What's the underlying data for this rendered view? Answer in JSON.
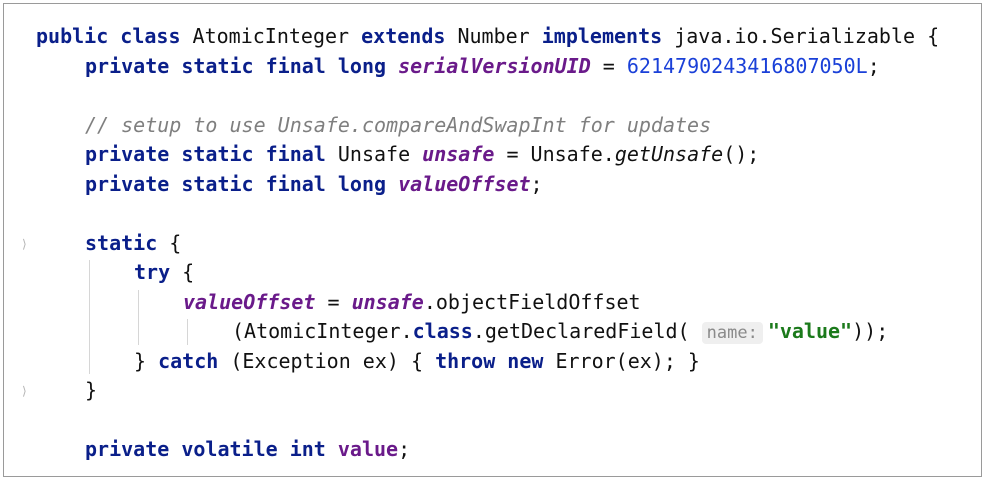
{
  "editor": {
    "language": "Java",
    "lines": [
      {
        "indent": 0,
        "tokens": [
          {
            "t": "public class",
            "c": "kw"
          },
          {
            "t": " AtomicInteger "
          },
          {
            "t": "extends",
            "c": "kw"
          },
          {
            "t": " Number "
          },
          {
            "t": "implements",
            "c": "kw"
          },
          {
            "t": " java.io.Serializable {"
          }
        ]
      },
      {
        "indent": 1,
        "tokens": [
          {
            "t": "private static final long",
            "c": "kw"
          },
          {
            "t": " "
          },
          {
            "t": "serialVersionUID",
            "c": "field"
          },
          {
            "t": " = "
          },
          {
            "t": "6214790243416807050L",
            "c": "num"
          },
          {
            "t": ";"
          }
        ]
      },
      {
        "indent": 0,
        "tokens": []
      },
      {
        "indent": 1,
        "tokens": [
          {
            "t": "// setup to use Unsafe.compareAndSwapInt for updates",
            "c": "cmt"
          }
        ]
      },
      {
        "indent": 1,
        "tokens": [
          {
            "t": "private static final",
            "c": "kw"
          },
          {
            "t": " Unsafe "
          },
          {
            "t": "unsafe",
            "c": "field"
          },
          {
            "t": " = Unsafe."
          },
          {
            "t": "getUnsafe",
            "c": "mth"
          },
          {
            "t": "();"
          }
        ]
      },
      {
        "indent": 1,
        "tokens": [
          {
            "t": "private static final long",
            "c": "kw"
          },
          {
            "t": " "
          },
          {
            "t": "valueOffset",
            "c": "field"
          },
          {
            "t": ";"
          }
        ]
      },
      {
        "indent": 0,
        "tokens": []
      },
      {
        "indent": 1,
        "tokens": [
          {
            "t": "static",
            "c": "kw"
          },
          {
            "t": " {"
          }
        ]
      },
      {
        "indent": 2,
        "tokens": [
          {
            "t": "try",
            "c": "kw"
          },
          {
            "t": " {"
          }
        ]
      },
      {
        "indent": 3,
        "tokens": [
          {
            "t": "valueOffset",
            "c": "field"
          },
          {
            "t": " = "
          },
          {
            "t": "unsafe",
            "c": "field"
          },
          {
            "t": ".objectFieldOffset"
          }
        ]
      },
      {
        "indent": 4,
        "tokens": [
          {
            "t": "(AtomicInteger."
          },
          {
            "t": "class",
            "c": "kw"
          },
          {
            "t": ".getDeclaredField( "
          },
          {
            "t": "name:",
            "c": "hint"
          },
          {
            "t": "\"value\"",
            "c": "str"
          },
          {
            "t": "));"
          }
        ]
      },
      {
        "indent": 2,
        "tokens": [
          {
            "t": "} "
          },
          {
            "t": "catch",
            "c": "kw"
          },
          {
            "t": " (Exception ex) { "
          },
          {
            "t": "throw new",
            "c": "kw"
          },
          {
            "t": " Error(ex); }"
          }
        ]
      },
      {
        "indent": 1,
        "tokens": [
          {
            "t": "}"
          }
        ]
      },
      {
        "indent": 0,
        "tokens": []
      },
      {
        "indent": 1,
        "tokens": [
          {
            "t": "private volatile int",
            "c": "kw"
          },
          {
            "t": " "
          },
          {
            "t": "value",
            "c": "fieldp"
          },
          {
            "t": ";"
          }
        ]
      }
    ],
    "fold_markers": [
      7,
      12
    ],
    "indent_guides": [
      {
        "col": 1,
        "from": 8,
        "to": 11
      },
      {
        "col": 2,
        "from": 9,
        "to": 10
      },
      {
        "col": 3,
        "from": 10,
        "to": 10
      }
    ]
  },
  "colors": {
    "keyword": "#0a1f8a",
    "field": "#6a1a8a",
    "number": "#1a40d8",
    "comment": "#7f7f7f",
    "string": "#1b7a1b",
    "hint_bg": "#efefef"
  }
}
